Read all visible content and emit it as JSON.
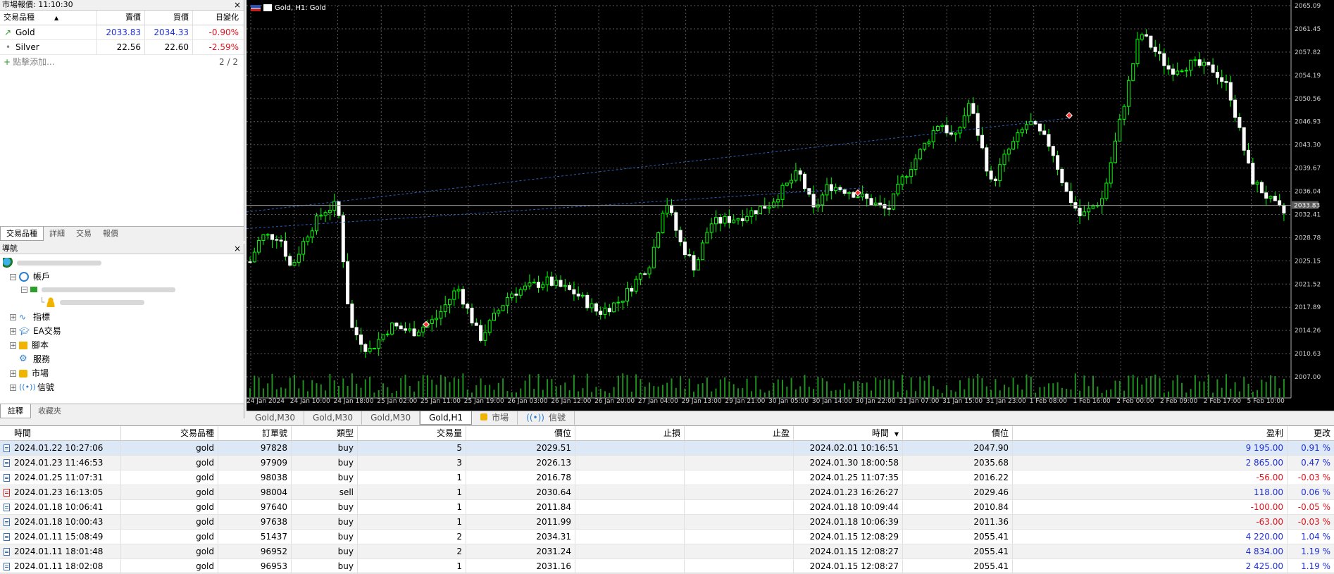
{
  "market_watch": {
    "title": "市場報價: 11:10:30",
    "close": "×",
    "headers": {
      "symbol": "交易品種",
      "bid": "賣價",
      "ask": "買價",
      "change": "日變化"
    },
    "rows": [
      {
        "symbol": "Gold",
        "bid": "2033.83",
        "ask": "2034.33",
        "change": "-0.90%"
      },
      {
        "symbol": "Silver",
        "bid": "22.56",
        "ask": "22.60",
        "change": "-2.59%"
      }
    ],
    "add": "點擊添加...",
    "count": "2 / 2",
    "tabs": [
      "交易品種",
      "詳細",
      "交易",
      "報價"
    ]
  },
  "navigator": {
    "title": "導航",
    "close": "×",
    "items": [
      "帳戶",
      "指標",
      "EA交易",
      "腳本",
      "服務",
      "市場",
      "信號"
    ],
    "tabs": [
      "註釋",
      "收藏夾"
    ]
  },
  "chart": {
    "title": "Gold, H1:  Gold",
    "current_price": "2033.83",
    "price_labels": [
      "2065.09",
      "2061.45",
      "2057.82",
      "2054.19",
      "2050.56",
      "2046.93",
      "2043.30",
      "2039.67",
      "2036.04",
      "2032.41",
      "2028.78",
      "2025.15",
      "2021.52",
      "2017.89",
      "2014.26",
      "2010.63",
      "2007.00"
    ],
    "time_labels": [
      "24 Jan 2024",
      "24 Jan 10:00",
      "24 Jan 18:00",
      "25 Jan 02:00",
      "25 Jan 11:00",
      "25 Jan 19:00",
      "26 Jan 03:00",
      "26 Jan 12:00",
      "26 Jan 20:00",
      "27 Jan 04:00",
      "29 Jan 13:00",
      "29 Jan 21:00",
      "30 Jan 05:00",
      "30 Jan 14:00",
      "30 Jan 22:00",
      "31 Jan 07:00",
      "31 Jan 15:00",
      "31 Jan 23:00",
      "1 Feb 08:00",
      "1 Feb 16:00",
      "2 Feb 00:00",
      "2 Feb 09:00",
      "2 Feb 17:00",
      "5 Feb 10:00"
    ],
    "candle_color": "#00ff00",
    "grid_color": "#5a5a5a"
  },
  "chart_tabs": [
    "Gold,M30",
    "Gold,M30",
    "Gold,M30",
    "Gold,H1",
    "市場",
    "信號"
  ],
  "trades": {
    "headers": [
      "時間",
      "交易品種",
      "訂單號",
      "類型",
      "交易量",
      "價位",
      "止損",
      "止盈",
      "時間",
      "價位",
      "盈利",
      "更改"
    ],
    "rows": [
      [
        "2024.01.22 10:27:06",
        "gold",
        "97828",
        "buy",
        "5",
        "2029.51",
        "",
        "",
        "2024.02.01 10:16:51",
        "2047.90",
        "9 195.00",
        "0.91 %"
      ],
      [
        "2024.01.23 11:46:53",
        "gold",
        "97909",
        "buy",
        "3",
        "2026.13",
        "",
        "",
        "2024.01.30 18:00:58",
        "2035.68",
        "2 865.00",
        "0.47 %"
      ],
      [
        "2024.01.25 11:07:31",
        "gold",
        "98038",
        "buy",
        "1",
        "2016.78",
        "",
        "",
        "2024.01.25 11:07:35",
        "2016.22",
        "-56.00",
        "-0.03 %"
      ],
      [
        "2024.01.23 16:13:05",
        "gold",
        "98004",
        "sell",
        "1",
        "2030.64",
        "",
        "",
        "2024.01.23 16:26:27",
        "2029.46",
        "118.00",
        "0.06 %"
      ],
      [
        "2024.01.18 10:06:41",
        "gold",
        "97640",
        "buy",
        "1",
        "2011.84",
        "",
        "",
        "2024.01.18 10:09:44",
        "2010.84",
        "-100.00",
        "-0.05 %"
      ],
      [
        "2024.01.18 10:00:43",
        "gold",
        "97638",
        "buy",
        "1",
        "2011.99",
        "",
        "",
        "2024.01.18 10:06:39",
        "2011.36",
        "-63.00",
        "-0.03 %"
      ],
      [
        "2024.01.11 15:08:49",
        "gold",
        "51437",
        "buy",
        "2",
        "2034.31",
        "",
        "",
        "2024.01.15 12:08:29",
        "2055.41",
        "4 220.00",
        "1.04 %"
      ],
      [
        "2024.01.11 18:01:48",
        "gold",
        "96952",
        "buy",
        "2",
        "2031.24",
        "",
        "",
        "2024.01.15 12:08:27",
        "2055.41",
        "4 834.00",
        "1.19 %"
      ],
      [
        "2024.01.11 18:02:08",
        "gold",
        "96953",
        "buy",
        "1",
        "2031.16",
        "",
        "",
        "2024.01.15 12:08:27",
        "2055.41",
        "2 425.00",
        "1.19 %"
      ]
    ]
  }
}
